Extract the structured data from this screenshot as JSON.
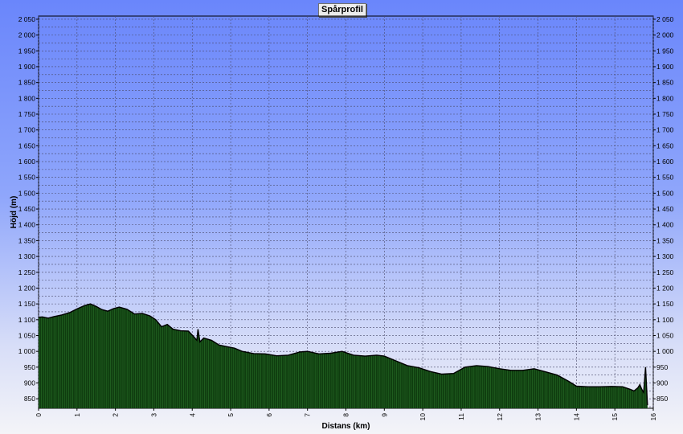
{
  "chart_data": {
    "type": "area",
    "title": "Spårprofil",
    "xlabel": "Distans (km)",
    "ylabel": "Höjd (m)",
    "xlim": [
      0,
      16
    ],
    "ylim": [
      820,
      2060
    ],
    "x_ticks": [
      "0",
      "1",
      "2",
      "3",
      "4",
      "5",
      "6",
      "7",
      "8",
      "9",
      "10",
      "11",
      "12",
      "13",
      "14",
      "15",
      "16"
    ],
    "y_ticks": [
      "2 050",
      "2 000",
      "1 950",
      "1 900",
      "1 850",
      "1 800",
      "1 750",
      "1 700",
      "1 650",
      "1 600",
      "1 550",
      "1 500",
      "1 450",
      "1 400",
      "1 350",
      "1 300",
      "1 250",
      "1 200",
      "1 150",
      "1 100",
      "1 050",
      "1 000",
      "950",
      "900",
      "850"
    ],
    "grid": true,
    "fill_color": "#0f3d0f",
    "stroke_color": "#000000",
    "x": [
      0,
      0.1,
      0.25,
      0.4,
      0.6,
      0.8,
      1.0,
      1.2,
      1.35,
      1.5,
      1.65,
      1.8,
      1.95,
      2.1,
      2.3,
      2.5,
      2.7,
      2.9,
      3.05,
      3.2,
      3.35,
      3.5,
      3.7,
      3.9,
      4.05,
      4.12,
      4.15,
      4.2,
      4.3,
      4.5,
      4.7,
      4.9,
      5.1,
      5.3,
      5.6,
      5.9,
      6.2,
      6.5,
      6.8,
      7.0,
      7.3,
      7.6,
      7.9,
      8.2,
      8.5,
      8.8,
      9.0,
      9.3,
      9.6,
      9.9,
      10.2,
      10.5,
      10.8,
      11.1,
      11.4,
      11.7,
      12.0,
      12.3,
      12.6,
      12.9,
      13.2,
      13.5,
      13.8,
      14.0,
      14.3,
      14.6,
      14.9,
      15.2,
      15.4,
      15.5,
      15.55,
      15.6,
      15.65,
      15.7,
      15.75,
      15.8,
      15.85
    ],
    "values": [
      1108,
      1109,
      1105,
      1110,
      1115,
      1122,
      1134,
      1145,
      1150,
      1142,
      1132,
      1127,
      1135,
      1140,
      1133,
      1118,
      1120,
      1112,
      1100,
      1078,
      1085,
      1070,
      1065,
      1064,
      1045,
      1035,
      1070,
      1030,
      1042,
      1035,
      1020,
      1015,
      1010,
      1000,
      993,
      992,
      986,
      988,
      998,
      1000,
      992,
      994,
      1000,
      988,
      985,
      988,
      985,
      970,
      955,
      948,
      936,
      928,
      930,
      950,
      955,
      952,
      945,
      940,
      940,
      945,
      935,
      925,
      905,
      890,
      888,
      888,
      889,
      888,
      880,
      875,
      880,
      885,
      895,
      880,
      870,
      950,
      830
    ]
  }
}
